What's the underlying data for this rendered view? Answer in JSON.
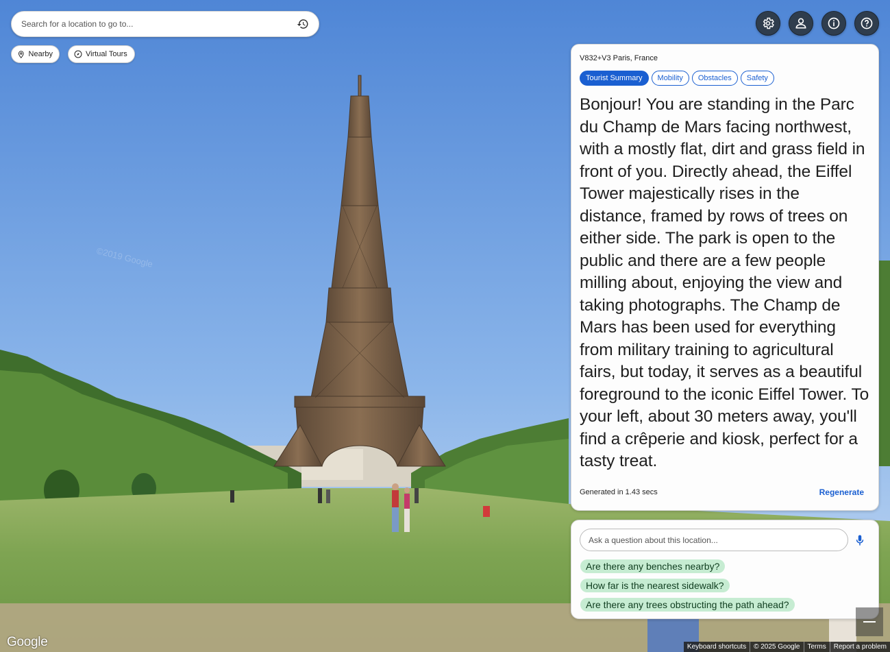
{
  "search": {
    "placeholder": "Search for a location to go to..."
  },
  "chips": {
    "nearby": "Nearby",
    "virtual_tours": "Virtual Tours"
  },
  "top_buttons": [
    {
      "name": "settings",
      "icon": "gear-icon"
    },
    {
      "name": "account",
      "icon": "person-icon"
    },
    {
      "name": "info",
      "icon": "info-icon"
    },
    {
      "name": "help",
      "icon": "question-icon"
    }
  ],
  "scene": {
    "watermark": "©2019 Google"
  },
  "summary_panel": {
    "address": "V832+V3 Paris, France",
    "tabs": [
      {
        "label": "Tourist Summary",
        "active": true
      },
      {
        "label": "Mobility",
        "active": false
      },
      {
        "label": "Obstacles",
        "active": false
      },
      {
        "label": "Safety",
        "active": false
      }
    ],
    "text": "Bonjour! You are standing in the Parc du Champ de Mars facing northwest, with a mostly flat, dirt and grass field in front of you. Directly ahead, the Eiffel Tower majestically rises in the distance, framed by rows of trees on either side. The park is open to the public and there are a few people milling about, enjoying the view and taking photographs. The Champ de Mars has been used for everything from military training to agricultural fairs, but today, it serves as a beautiful foreground to the iconic Eiffel Tower. To your left, about 30 meters away, you'll find a crêperie and kiosk, perfect for a tasty treat.",
    "generated": "Generated in 1.43 secs",
    "regenerate": "Regenerate"
  },
  "question_panel": {
    "placeholder": "Ask a question about this location...",
    "suggestions": [
      "Are there any benches nearby?",
      "How far is the nearest sidewalk?",
      "Are there any trees obstructing the path ahead?"
    ]
  },
  "footer": {
    "logo": "Google",
    "links": [
      "Keyboard shortcuts",
      "© 2025 Google",
      "Terms",
      "Report a problem"
    ]
  },
  "colors": {
    "accent": "#1a5fd1",
    "round_button": "#2f3d4d",
    "suggestion_bg": "#c6ecd2"
  }
}
